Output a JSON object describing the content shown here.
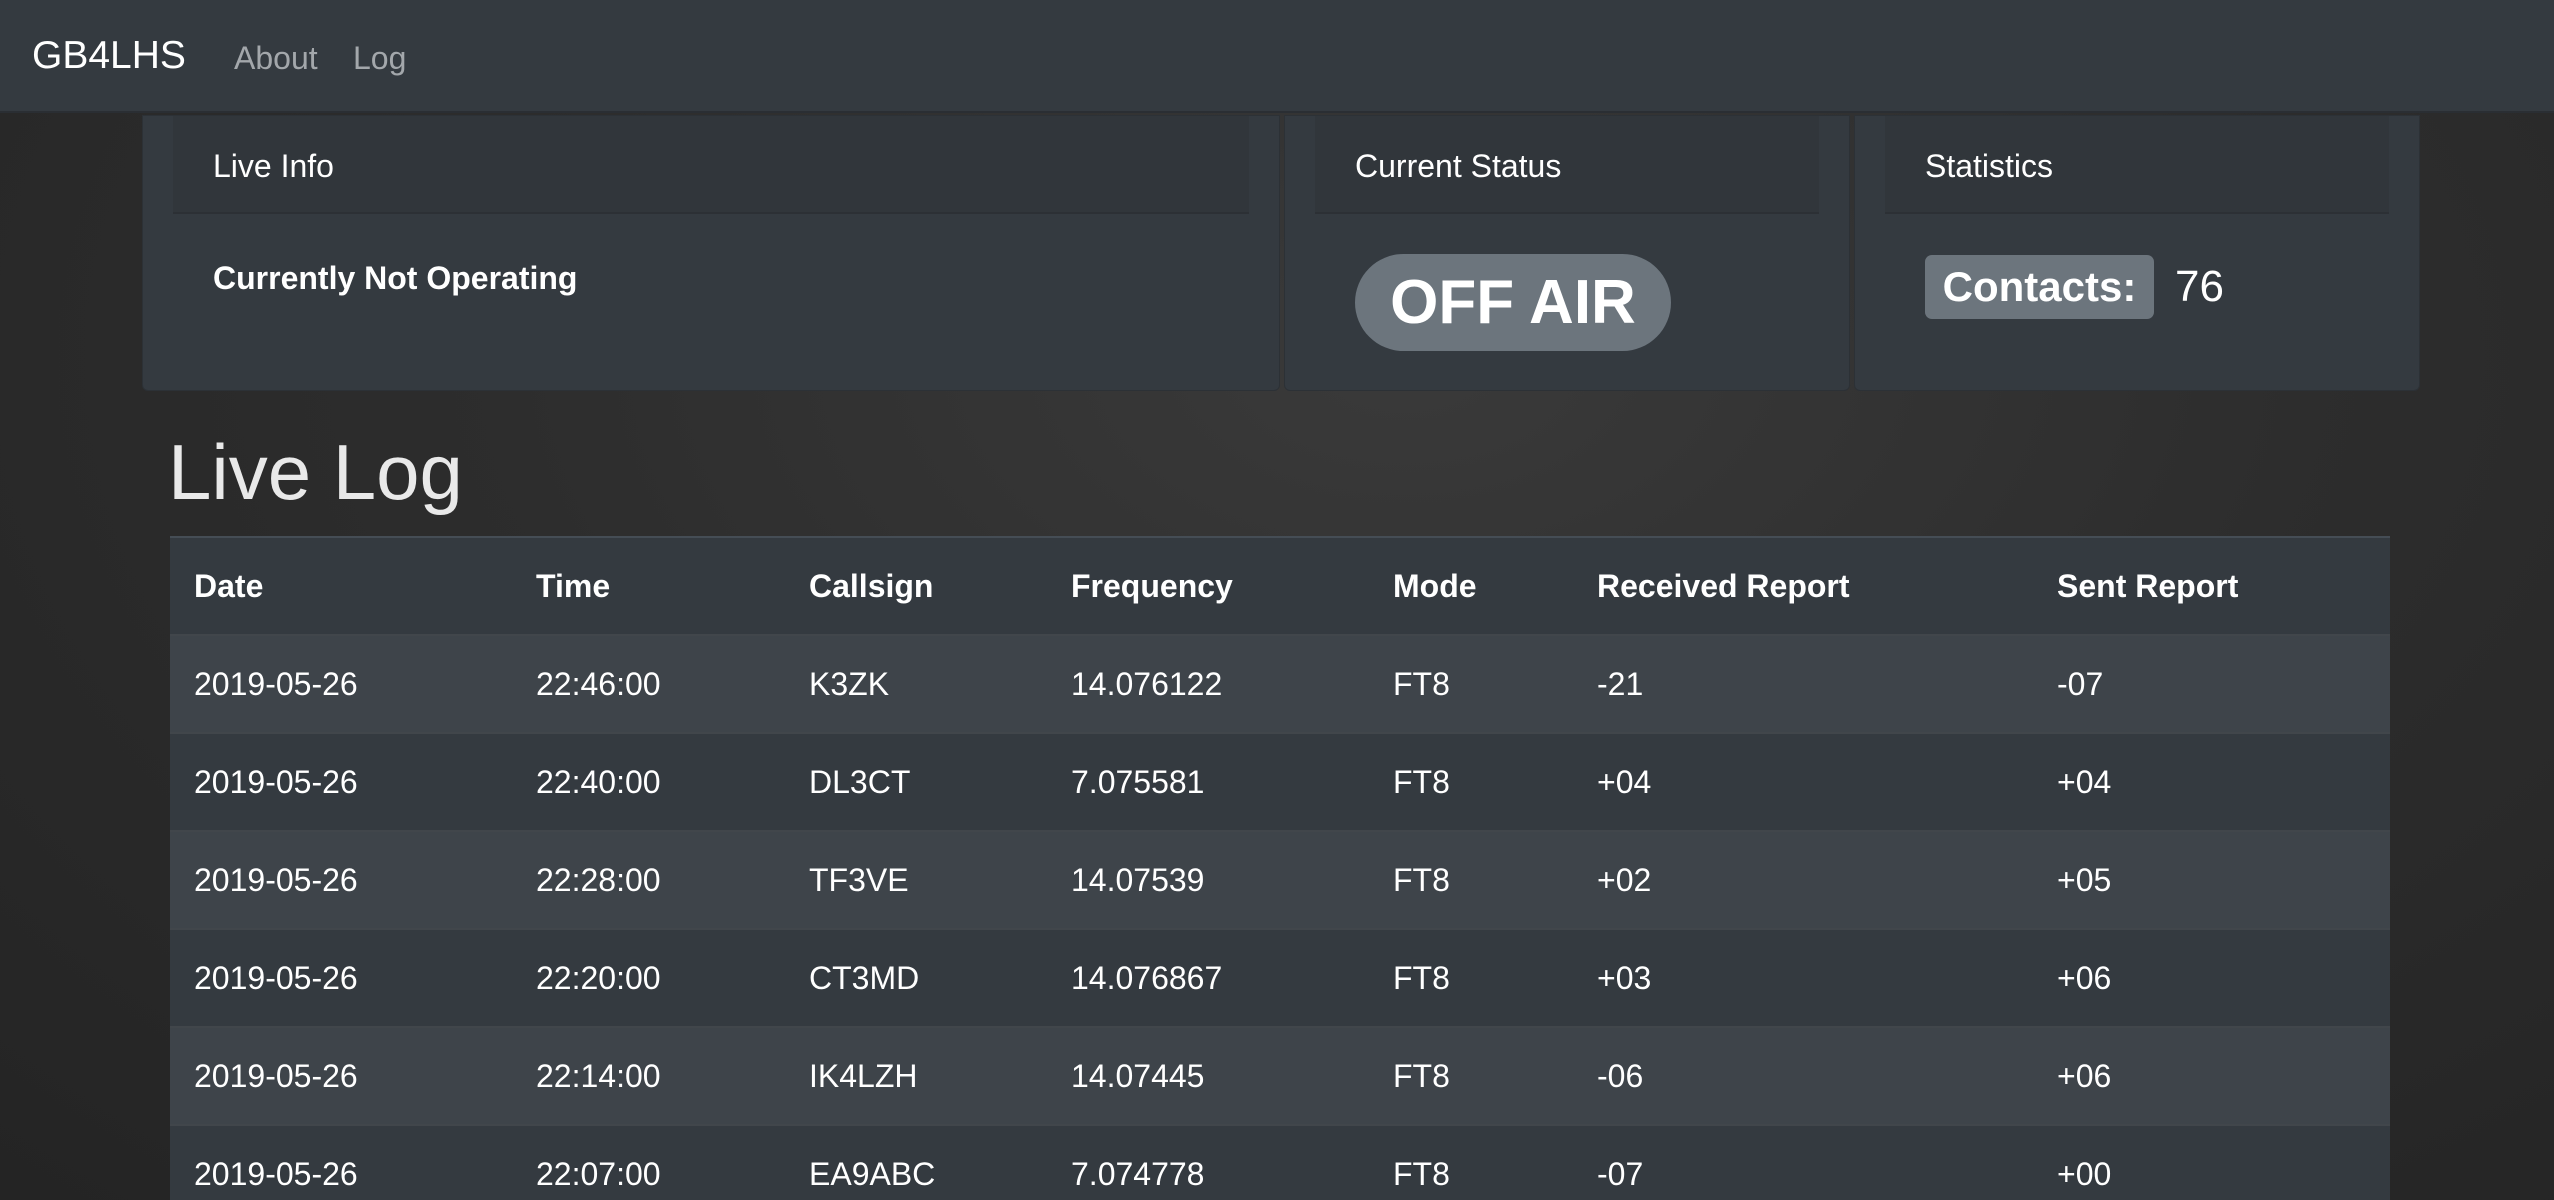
{
  "nav": {
    "brand": "GB4LHS",
    "links": [
      "About",
      "Log"
    ]
  },
  "cards": {
    "live": {
      "header": "Live Info",
      "text": "Currently Not Operating"
    },
    "status": {
      "header": "Current Status",
      "badge": "OFF AIR"
    },
    "stats": {
      "header": "Statistics",
      "contacts_label": "Contacts:",
      "contacts_value": "76"
    }
  },
  "log": {
    "title": "Live Log",
    "columns": [
      "Date",
      "Time",
      "Callsign",
      "Frequency",
      "Mode",
      "Received Report",
      "Sent Report"
    ],
    "rows": [
      [
        "2019-05-26",
        "22:46:00",
        "K3ZK",
        "14.076122",
        "FT8",
        "-21",
        "-07"
      ],
      [
        "2019-05-26",
        "22:40:00",
        "DL3CT",
        "7.075581",
        "FT8",
        "+04",
        "+04"
      ],
      [
        "2019-05-26",
        "22:28:00",
        "TF3VE",
        "14.07539",
        "FT8",
        "+02",
        "+05"
      ],
      [
        "2019-05-26",
        "22:20:00",
        "CT3MD",
        "14.076867",
        "FT8",
        "+03",
        "+06"
      ],
      [
        "2019-05-26",
        "22:14:00",
        "IK4LZH",
        "14.07445",
        "FT8",
        "-06",
        "+06"
      ],
      [
        "2019-05-26",
        "22:07:00",
        "EA9ABC",
        "7.074778",
        "FT8",
        "-07",
        "+00"
      ]
    ]
  },
  "colors": {
    "navbar": "#343a40",
    "badge": "#6c757d",
    "row_striped": "#3e444a"
  }
}
